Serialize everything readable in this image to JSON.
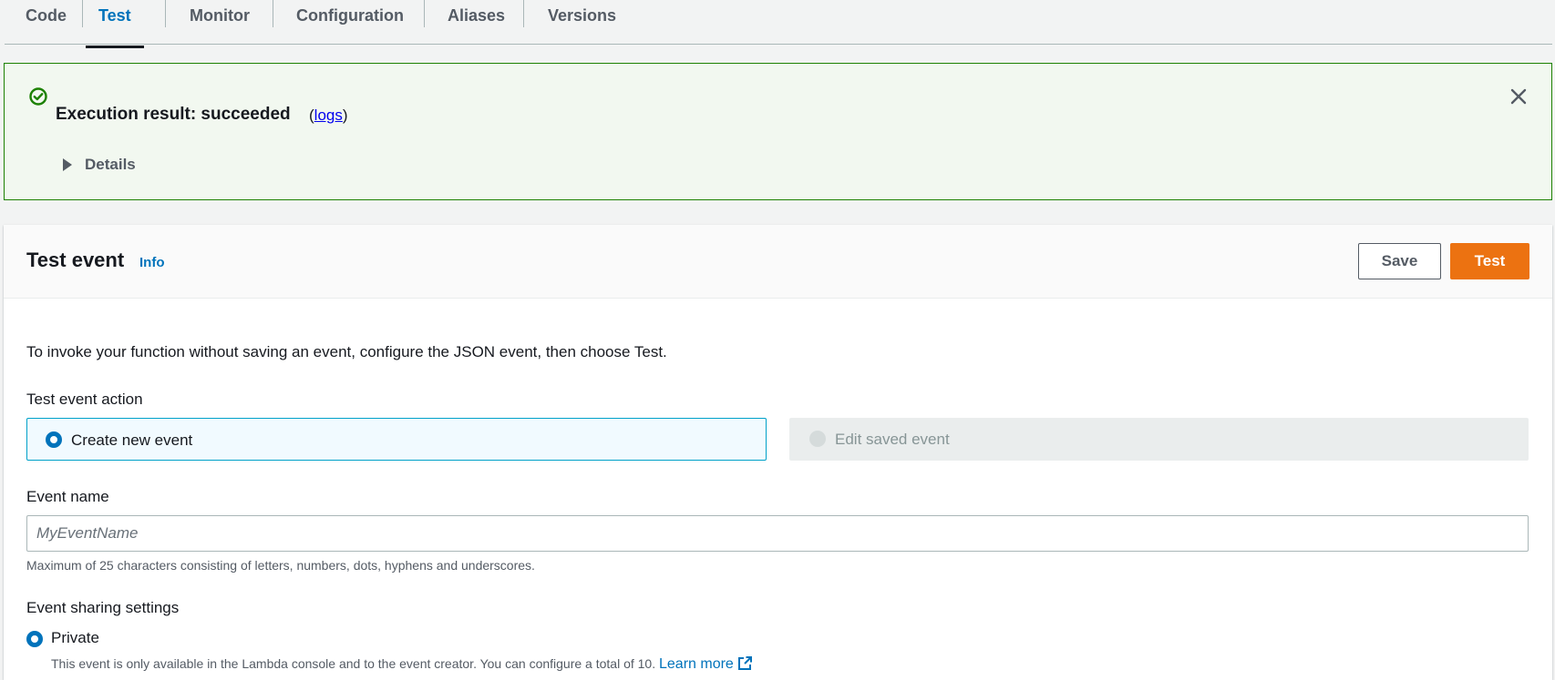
{
  "tabs": [
    {
      "label": "Code"
    },
    {
      "label": "Test",
      "active": true
    },
    {
      "label": "Monitor"
    },
    {
      "label": "Configuration"
    },
    {
      "label": "Aliases"
    },
    {
      "label": "Versions"
    }
  ],
  "flash": {
    "title": "Execution result: succeeded",
    "logs_open": "(",
    "logs_link": "logs",
    "logs_close": ")",
    "details_label": "Details",
    "status_color": "#1d8102",
    "icons": [
      "check-circle-icon",
      "close-icon",
      "caret-right-icon"
    ]
  },
  "test_event": {
    "title": "Test event",
    "info_link": "Info",
    "save_label": "Save",
    "test_label": "Test",
    "description": "To invoke your function without saving an event, configure the JSON event, then choose Test.",
    "action_label": "Test event action",
    "create_new_label": "Create new event",
    "edit_saved_label": "Edit saved event",
    "selected_action": "Create new event",
    "event_name_label": "Event name",
    "event_name_value": "",
    "event_name_placeholder": "MyEventName",
    "event_name_hint": "Maximum of 25 characters consisting of letters, numbers, dots, hyphens and underscores.",
    "sharing_label": "Event sharing settings",
    "private_label": "Private",
    "private_desc": "This event is only available in the Lambda console and to the event creator. You can configure a total of 10.",
    "learn_more": "Learn more",
    "accent_color": "#ec7211",
    "link_color": "#0073bb"
  }
}
